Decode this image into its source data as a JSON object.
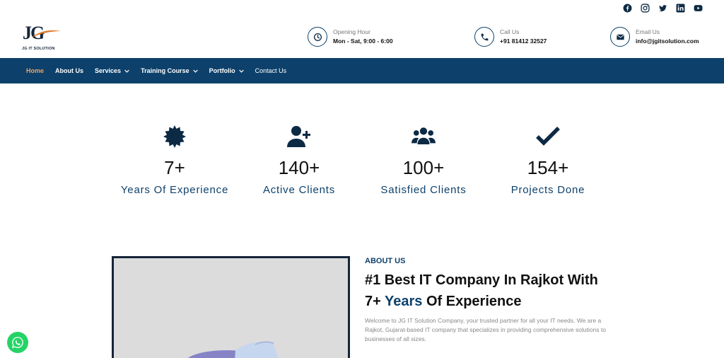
{
  "social": [
    "facebook-icon",
    "instagram-icon",
    "twitter-icon",
    "linkedin-icon",
    "youtube-icon"
  ],
  "logo": {
    "mark": "JG",
    "text": "JG IT SOLUTION"
  },
  "contacts": [
    {
      "icon": "clock-icon",
      "label": "Opening Hour",
      "value": "Mon - Sat, 9:00 - 6:00"
    },
    {
      "icon": "phone-icon",
      "label": "Call Us",
      "value": "+91 81412 32527"
    },
    {
      "icon": "mail-icon",
      "label": "Email Us",
      "value": "info@jgitsolution.com"
    }
  ],
  "nav": [
    {
      "label": "Home",
      "active": true
    },
    {
      "label": "About Us"
    },
    {
      "label": "Services",
      "dropdown": true
    },
    {
      "label": "Training Course",
      "dropdown": true
    },
    {
      "label": "Portfolio",
      "dropdown": true
    },
    {
      "label": "Contact Us"
    }
  ],
  "stats": [
    {
      "icon": "badge-icon",
      "number": "7+",
      "label": "Years Of Experience"
    },
    {
      "icon": "user-plus-icon",
      "number": "140+",
      "label": "Active Clients"
    },
    {
      "icon": "users-icon",
      "number": "100+",
      "label": "Satisfied Clients"
    },
    {
      "icon": "check-icon",
      "number": "154+",
      "label": "Projects Done"
    }
  ],
  "about": {
    "kicker": "ABOUT US",
    "title_line1": "#1 Best IT Company In Rajkot With",
    "title_prefix": "7+",
    "title_accent": "Years",
    "title_suffix": "Of Experience",
    "body": "Welcome to JG IT Solution Company, your trusted partner for all your IT needs. We are a Rajkot, Gujarat-based IT company that specializes in providing comprehensive solutions to businesses of all sizes."
  },
  "colors": {
    "brand": "#0d416b",
    "nav_active": "#f0a35e",
    "whatsapp": "#25d366"
  }
}
